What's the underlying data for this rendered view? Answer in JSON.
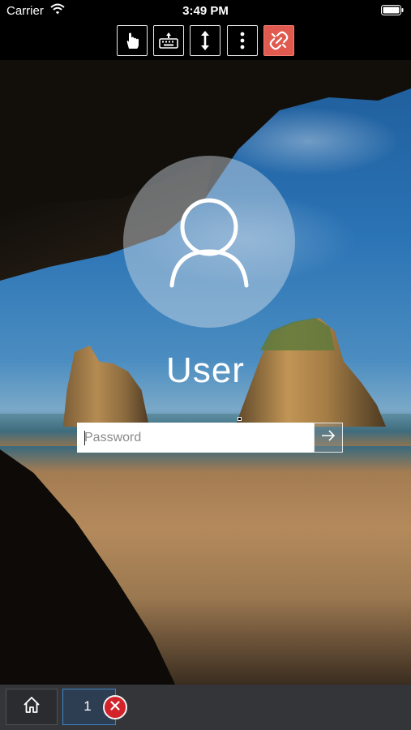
{
  "status_bar": {
    "carrier": "Carrier",
    "time": "3:49 PM",
    "wifi_icon": "wifi-icon",
    "battery_icon": "battery-icon"
  },
  "toolbar": {
    "buttons": [
      {
        "name": "touch-mode-button",
        "icon": "hand-pointer-icon"
      },
      {
        "name": "keyboard-button",
        "icon": "keyboard-icon"
      },
      {
        "name": "scroll-button",
        "icon": "vertical-arrows-icon"
      },
      {
        "name": "more-options-button",
        "icon": "vertical-dots-icon"
      },
      {
        "name": "disconnect-button",
        "icon": "broken-link-icon",
        "color": "#e05a4f"
      }
    ]
  },
  "lock_screen": {
    "user_name": "User",
    "password_placeholder": "Password",
    "password_value": "",
    "submit_icon": "arrow-right-icon",
    "avatar_icon": "user-avatar-icon"
  },
  "bottom_bar": {
    "home_icon": "home-icon",
    "session_tab_label": "1",
    "close_icon": "close-icon",
    "close_color": "#d3222a"
  }
}
